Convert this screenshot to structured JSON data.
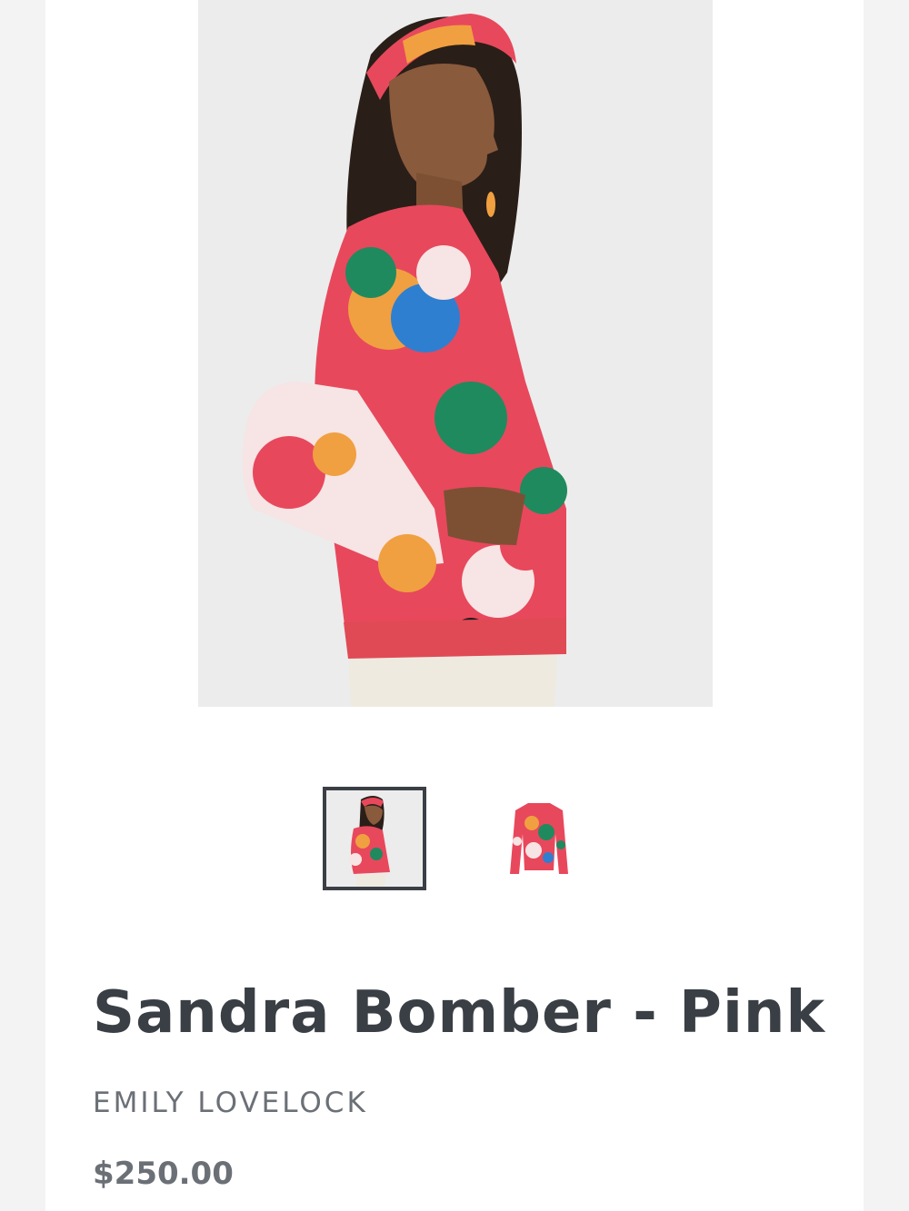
{
  "product": {
    "title": "Sandra Bomber - Pink",
    "vendor": "EMILY LOVELOCK",
    "price": "$250.00"
  },
  "gallery": {
    "main_image_alt": "Model wearing Sandra Bomber in pink floral print, side view",
    "thumbnails": [
      {
        "alt": "Sandra Bomber - Pink model side view",
        "selected": true
      },
      {
        "alt": "Sandra Bomber - Pink flat lay front view",
        "selected": false
      }
    ]
  },
  "colors": {
    "text_dark": "#3a3f45",
    "text_muted": "#6b7077",
    "print_pink": "#e8485c",
    "print_orange": "#f0a040",
    "print_green": "#1f8a5e",
    "print_blue": "#2f7fd0"
  }
}
